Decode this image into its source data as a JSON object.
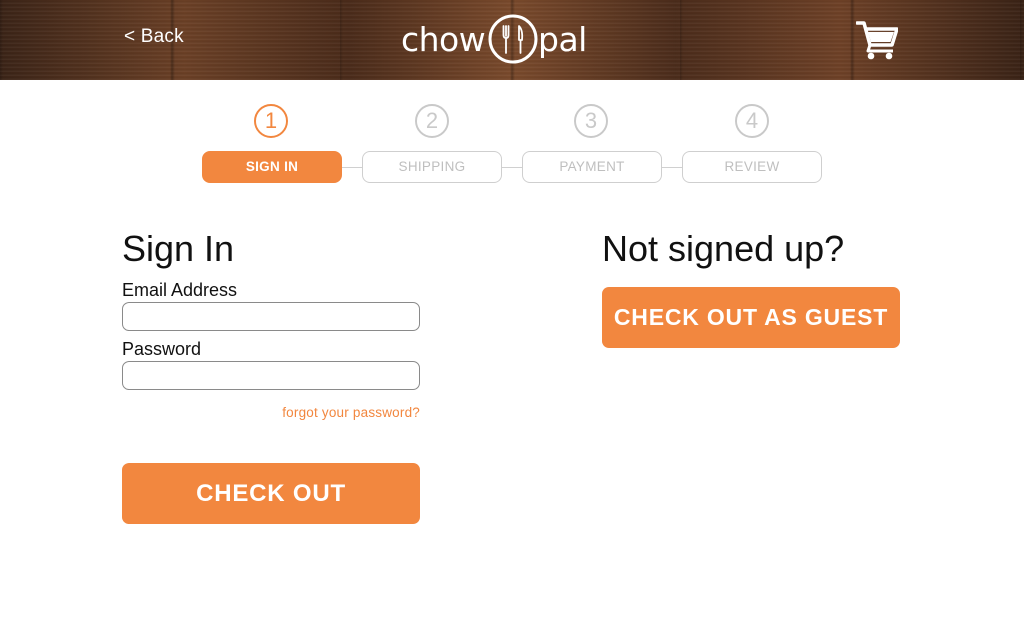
{
  "header": {
    "back_label": "< Back",
    "logo_left": "chow",
    "logo_right": "pal",
    "cart_icon": "cart-icon"
  },
  "steps": [
    {
      "number": "1",
      "label": "SIGN IN",
      "active": true
    },
    {
      "number": "2",
      "label": "SHIPPING",
      "active": false
    },
    {
      "number": "3",
      "label": "PAYMENT",
      "active": false
    },
    {
      "number": "4",
      "label": "REVIEW",
      "active": false
    }
  ],
  "signin": {
    "title": "Sign In",
    "email_label": "Email Address",
    "email_value": "",
    "password_label": "Password",
    "password_value": "",
    "forgot_label": "forgot your password?",
    "checkout_label": "CHECK OUT"
  },
  "guest": {
    "title": "Not signed up?",
    "guest_label": "CHECK OUT AS GUEST"
  },
  "colors": {
    "accent": "#f2873f",
    "inactive": "#c9c9c9"
  }
}
